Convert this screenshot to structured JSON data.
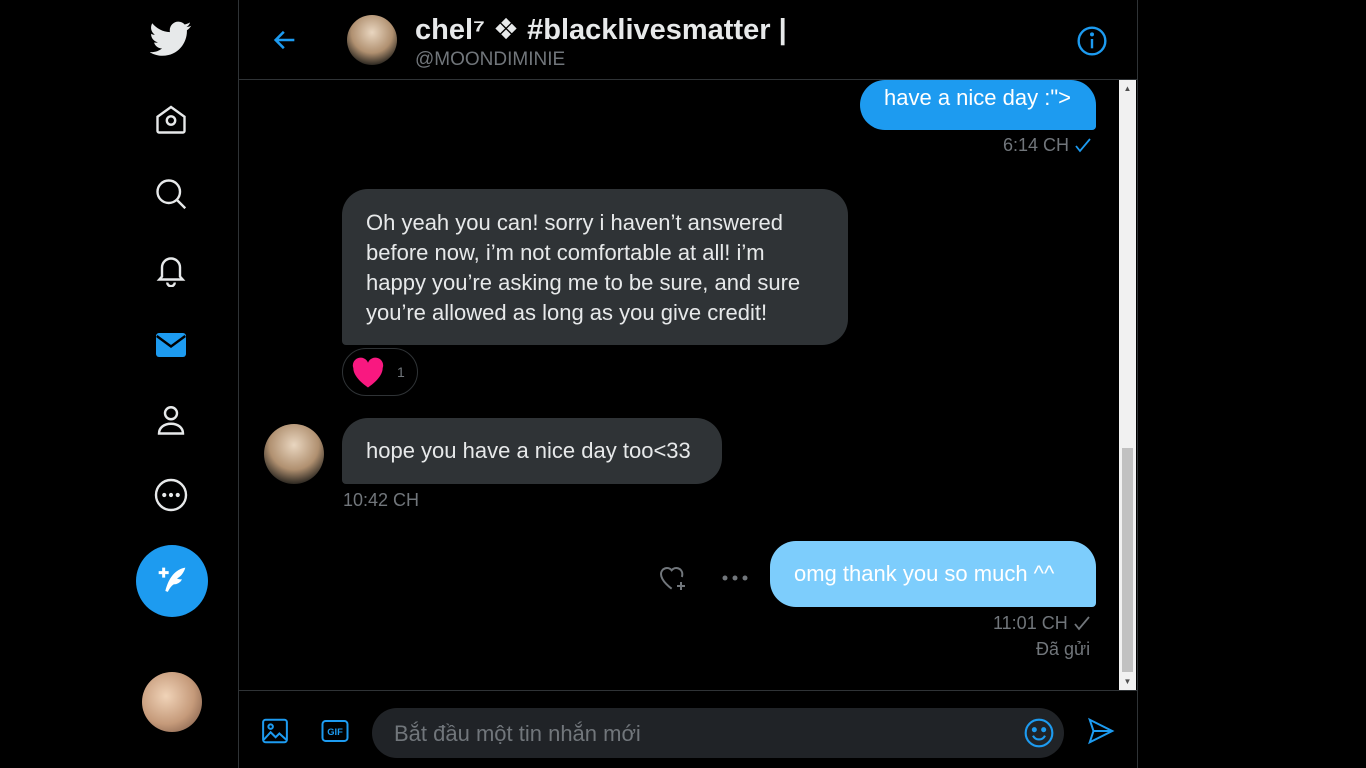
{
  "nav": {
    "items": [
      {
        "name": "twitter-logo-icon"
      },
      {
        "name": "home-icon"
      },
      {
        "name": "explore-icon"
      },
      {
        "name": "notifications-icon"
      },
      {
        "name": "messages-icon",
        "active": true
      },
      {
        "name": "profile-icon"
      },
      {
        "name": "more-icon"
      }
    ],
    "compose_icon": "compose-tweet-icon"
  },
  "header": {
    "name": "chel⁷ ❖ #blacklivesmatter |",
    "handle": "@MOONDIMINIE"
  },
  "messages": [
    {
      "direction": "sent",
      "text": "have a nice day :\">",
      "time": "6:14 CH",
      "status": "read"
    },
    {
      "direction": "received",
      "text": "Oh yeah you can! sorry i haven’t answered before now, i’m not comfortable at all! i’m happy you’re asking me to be sure, and sure you’re allowed as long as you give credit!",
      "reaction": {
        "emoji": "heart",
        "count": "1"
      }
    },
    {
      "direction": "received",
      "text": "hope you have a nice day too<33",
      "time": "10:42 CH"
    },
    {
      "direction": "sent",
      "text": "omg thank you so much ^^",
      "time": "11:01 CH",
      "status_text": "Đã gửi"
    }
  ],
  "composer": {
    "placeholder": "Bắt đầu một tin nhắn mới",
    "value": ""
  },
  "colors": {
    "accent": "#1d9bf0",
    "pending_bubble": "#7dcdfc",
    "received_bubble": "#2f3336",
    "background": "#000000",
    "heart": "#f91880"
  }
}
